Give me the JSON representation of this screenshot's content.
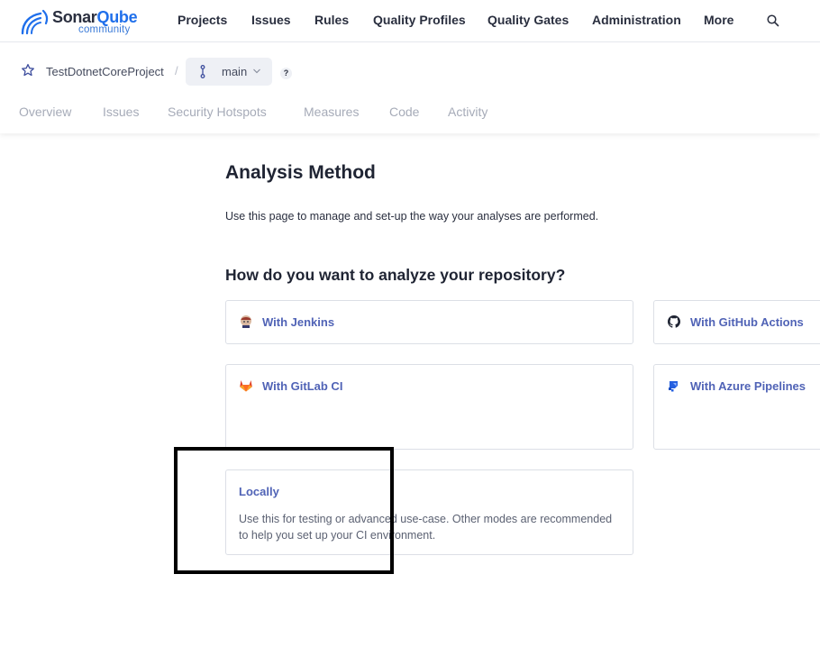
{
  "logo": {
    "word_a": "Sonar",
    "word_b": "Qube",
    "sub": "community"
  },
  "nav": {
    "items": [
      "Projects",
      "Issues",
      "Rules",
      "Quality Profiles",
      "Quality Gates",
      "Administration",
      "More"
    ],
    "search_icon": "search-icon"
  },
  "project": {
    "name": "TestDotnetCoreProject",
    "separator": "/",
    "branch": "main",
    "help": "?",
    "tabs": [
      "Overview",
      "Issues",
      "Security Hotspots",
      "Measures",
      "Code",
      "Activity"
    ]
  },
  "main": {
    "title": "Analysis Method",
    "description": "Use this page to manage and set-up the way your analyses are performed.",
    "section_title": "How do you want to analyze your repository?",
    "options": {
      "jenkins": {
        "label": "With Jenkins",
        "icon": "jenkins-icon"
      },
      "github": {
        "label": "With GitHub Actions",
        "icon": "github-icon"
      },
      "gitlab": {
        "label": "With GitLab CI",
        "icon": "gitlab-icon"
      },
      "azure": {
        "label": "With Azure Pipelines",
        "icon": "azure-pipelines-icon"
      },
      "locally": {
        "label": "Locally",
        "description": "Use this for testing or advanced use-case. Other modes are recommended to help you set up your CI environment."
      }
    }
  },
  "colors": {
    "accent": "#5063b6",
    "brand": "#1f6feb",
    "text": "#2a2f3f",
    "muted": "#a6abb8",
    "highlight_border": "#000000"
  }
}
